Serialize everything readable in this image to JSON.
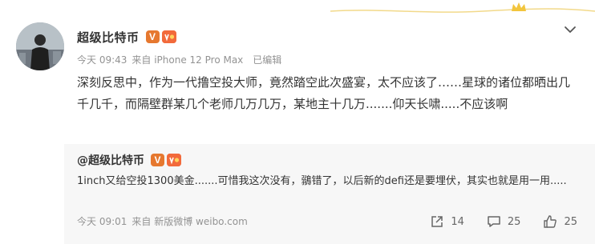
{
  "post": {
    "username": "超级比特币",
    "verified_badge": "V",
    "meta_time": "今天 09:43",
    "meta_source": "来自 iPhone 12 Pro Max",
    "meta_edited": "已编辑",
    "text": "深刻反思中，作为一代撸空投大师，竟然踏空此次盛宴，太不应该了……星球的诸位都晒出几千几千，而隔壁群某几个老师几万几万，某地主十几万.......仰天长啸.....不应该啊"
  },
  "repost": {
    "username": "@超级比特币",
    "verified_badge": "V",
    "text": "1inch又给空投1300美金.......可惜我这次没有，鶸错了，以后新的defi还是要埋伏，其实也就是用一用.....",
    "meta_time": "今天 09:01",
    "meta_source": "来自 新版微博 weibo.com",
    "actions": {
      "share_count": "14",
      "comment_count": "25",
      "like_count": "25"
    }
  },
  "icons": {
    "menu": "chevron-down-icon",
    "share": "share-icon",
    "comment": "comment-icon",
    "like": "like-icon",
    "crown": "crown-icon"
  },
  "colors": {
    "accent_orange": "#e6782f",
    "deco_gold": "#f2c53d",
    "meta_gray": "#939393",
    "repost_bg": "#f7f7f7"
  }
}
